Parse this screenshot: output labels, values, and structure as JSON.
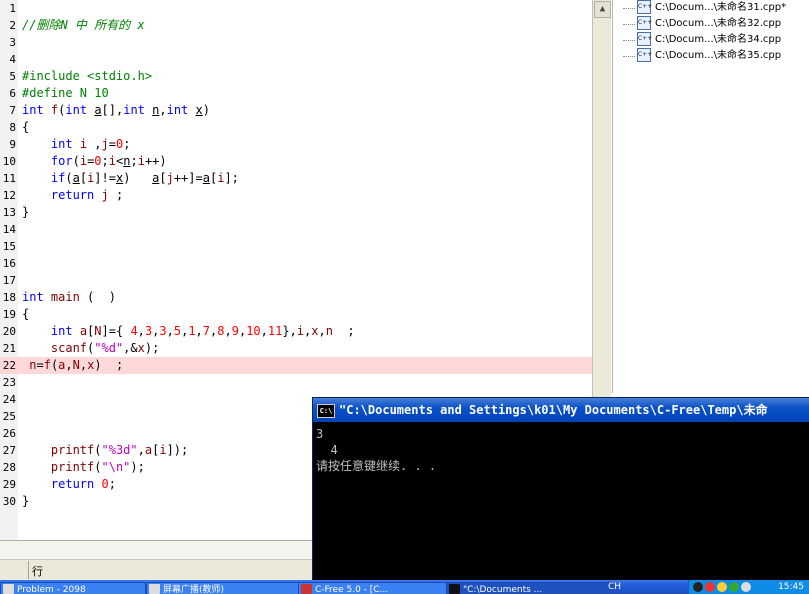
{
  "editor": {
    "lines": [
      {
        "n": "1",
        "html": ""
      },
      {
        "n": "2",
        "html": "<span class='cmt'>//删除N 中 所有的 x</span>"
      },
      {
        "n": "3",
        "html": ""
      },
      {
        "n": "4",
        "html": ""
      },
      {
        "n": "5",
        "html": "<span class='pp'>#include &lt;stdio.h&gt;</span>"
      },
      {
        "n": "6",
        "html": "<span class='pp'>#define N 10</span>"
      },
      {
        "n": "7",
        "html": "<span class='kw'>int</span> <span class='kw2'>f</span>(<span class='kw'>int</span> <span class='u'>a</span>[],<span class='kw'>int</span> <span class='u'>n</span>,<span class='kw'>int</span> <span class='u'>x</span>)"
      },
      {
        "n": "8",
        "html": "{"
      },
      {
        "n": "9",
        "html": "    <span class='kw'>int</span> <span class='kw2'>i</span> ,<span class='kw2'>j</span>=<span class='num'>0</span>;"
      },
      {
        "n": "10",
        "html": "    <span class='kw'>for</span>(<span class='kw2'>i</span>=<span class='num'>0</span>;<span class='kw2'>i</span>&lt;<span class='u'>n</span>;<span class='kw2'>i</span>++)"
      },
      {
        "n": "11",
        "html": "    <span class='kw'>if</span>(<span class='u'>a</span>[<span class='kw2'>i</span>]!=<span class='u'>x</span>)   <span class='u'>a</span>[<span class='kw2'>j</span>++]=<span class='u'>a</span>[<span class='kw2'>i</span>];"
      },
      {
        "n": "12",
        "html": "    <span class='kw'>return</span> <span class='kw2'>j</span> ;"
      },
      {
        "n": "13",
        "html": "}"
      },
      {
        "n": "14",
        "html": ""
      },
      {
        "n": "15",
        "html": ""
      },
      {
        "n": "16",
        "html": ""
      },
      {
        "n": "17",
        "html": ""
      },
      {
        "n": "18",
        "html": "<span class='kw'>int</span> <span class='kw2'>main</span> (  )"
      },
      {
        "n": "19",
        "html": "{"
      },
      {
        "n": "20",
        "html": "    <span class='kw'>int</span> <span class='kw2'>a</span>[<span class='kw2'>N</span>]={ <span class='num'>4</span>,<span class='num'>3</span>,<span class='num'>3</span>,<span class='num'>5</span>,<span class='num'>1</span>,<span class='num'>7</span>,<span class='num'>8</span>,<span class='num'>9</span>,<span class='num'>10</span>,<span class='num'>11</span>},<span class='kw2'>i</span>,<span class='kw2'>x</span>,<span class='kw2'>n</span>  ;"
      },
      {
        "n": "21",
        "html": "    <span class='kw2'>scanf</span>(<span class='str'>\"%d\"</span>,&amp;<span class='kw2'>x</span>);"
      },
      {
        "n": "22",
        "html": " <span class='kw2'>n</span>=<span class='kw2'>f</span>(<span class='kw2'>a</span>,<span class='kw2'>N</span>,<span class='kw2'>x</span>)  ;",
        "hl": true
      },
      {
        "n": "23",
        "html": ""
      },
      {
        "n": "24",
        "html": ""
      },
      {
        "n": "25",
        "html": ""
      },
      {
        "n": "26",
        "html": ""
      },
      {
        "n": "27",
        "html": "    <span class='kw2'>printf</span>(<span class='str'>\"%3d\"</span>,<span class='kw2'>a</span>[<span class='kw2'>i</span>]);"
      },
      {
        "n": "28",
        "html": "    <span class='kw2'>printf</span>(<span class='str'>\"\\n\"</span>);"
      },
      {
        "n": "29",
        "html": "    <span class='kw'>return</span> <span class='num'>0</span>;"
      },
      {
        "n": "30",
        "html": "}"
      }
    ]
  },
  "files": [
    "C:\\Docum...\\未命名31.cpp*",
    "C:\\Docum...\\未命名32.cpp",
    "C:\\Docum...\\未命名34.cpp",
    "C:\\Docum...\\未命名35.cpp"
  ],
  "status": {
    "row_label": "行"
  },
  "console": {
    "title": "\"C:\\Documents and Settings\\k01\\My Documents\\C-Free\\Temp\\未命",
    "icon": "C:\\",
    "output": "3\n  4\n请按任意键继续. . ."
  },
  "taskbar": {
    "tasks": [
      {
        "label": "Problem - 2098",
        "active": false
      },
      {
        "label": "屏幕广播(教师)",
        "active": false
      },
      {
        "label": "C-Free 5.0 - [C...",
        "active": false
      },
      {
        "label": "\"C:\\Documents ...",
        "active": true
      }
    ],
    "lang": "CH",
    "clock": "15:45"
  }
}
